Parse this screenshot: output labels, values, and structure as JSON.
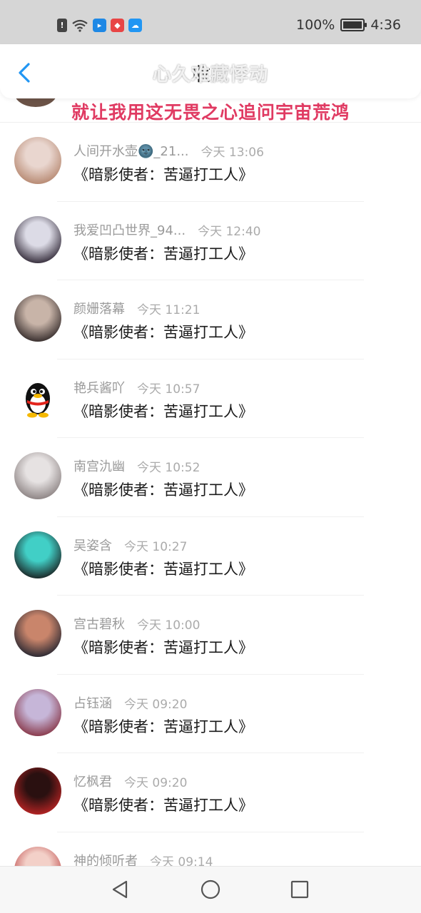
{
  "status_bar": {
    "battery": "100%",
    "time": "4:36",
    "battery_level": 1.0,
    "icons": [
      "alert-icon",
      "wifi-icon",
      "app-blue-icon",
      "app-red-icon",
      "weather-icon"
    ]
  },
  "header": {
    "title": "收藏",
    "overlay_text": "心久难藏悸动",
    "back_icon": "chevron-left-icon"
  },
  "banner": {
    "text": "就让我用这无畏之心追问宇宙荒鸿"
  },
  "items": [
    {
      "name": "人间开水壶🌚_21...",
      "time": "今天 13:06",
      "message": "《暗影使者：苦逼打工人》",
      "avatar": [
        "#e9d6cf",
        "#b88b74"
      ]
    },
    {
      "name": "我爱凹凸世界_94...",
      "time": "今天 12:40",
      "message": "《暗影使者：苦逼打工人》",
      "avatar": [
        "#dcdbe6",
        "#3a3240"
      ]
    },
    {
      "name": "颜姗落幕",
      "time": "今天 11:21",
      "message": "《暗影使者：苦逼打工人》",
      "avatar": [
        "#c8b4a8",
        "#3b3130"
      ]
    },
    {
      "name": "艳兵酱吖",
      "time": "今天 10:57",
      "message": "《暗影使者：苦逼打工人》",
      "avatar": [
        "#ffffff",
        "#ffffff"
      ]
    },
    {
      "name": "南宫氿幽",
      "time": "今天 10:52",
      "message": "《暗影使者：苦逼打工人》",
      "avatar": [
        "#e6e2e2",
        "#8f8686"
      ]
    },
    {
      "name": "吴姿含",
      "time": "今天 10:27",
      "message": "《暗影使者：苦逼打工人》",
      "avatar": [
        "#41cfc6",
        "#1c2a2a"
      ]
    },
    {
      "name": "宫古碧秋",
      "time": "今天 10:00",
      "message": "《暗影使者：苦逼打工人》",
      "avatar": [
        "#c9856b",
        "#2d2a33"
      ]
    },
    {
      "name": "占钰涵",
      "time": "今天 09:20",
      "message": "《暗影使者：苦逼打工人》",
      "avatar": [
        "#c6b6d8",
        "#8a3b4d"
      ]
    },
    {
      "name": "忆枫君",
      "time": "今天 09:20",
      "message": "《暗影使者：苦逼打工人》",
      "avatar": [
        "#2a1010",
        "#b22323"
      ]
    },
    {
      "name": "神的倾听者",
      "time": "今天 09:14",
      "message": "",
      "avatar": [
        "#f3d0c8",
        "#c05050"
      ]
    }
  ],
  "nav_bar": {
    "back": "triangle-back-icon",
    "home": "circle-home-icon",
    "recents": "square-recents-icon"
  }
}
